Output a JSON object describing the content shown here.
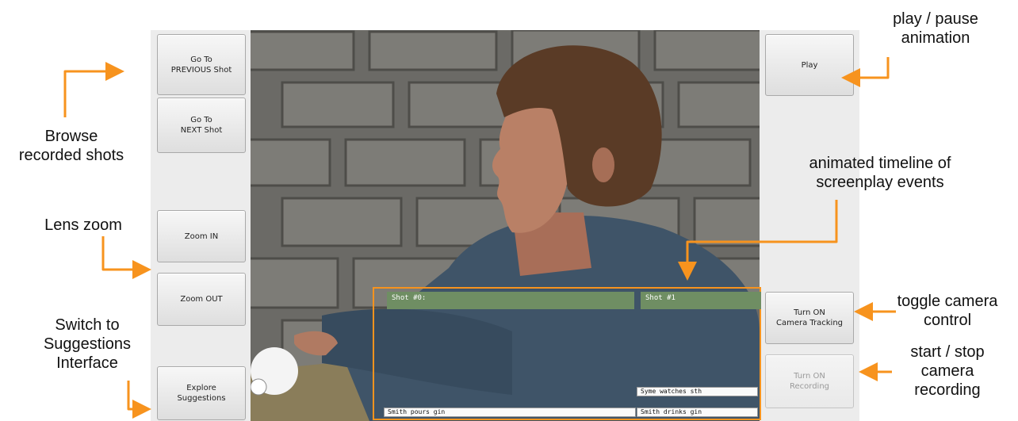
{
  "left_panel": {
    "buttons": [
      {
        "label": "Go To\nPREVIOUS Shot"
      },
      {
        "label": "Go To\nNEXT Shot"
      },
      {
        "label": "Zoom IN"
      },
      {
        "label": "Zoom OUT"
      },
      {
        "label": "Explore\nSuggestions"
      }
    ]
  },
  "right_panel": {
    "buttons": [
      {
        "label": "Play"
      },
      {
        "label": "Turn ON\nCamera Tracking"
      },
      {
        "label": "Turn ON\nRecording",
        "disabled": true
      }
    ]
  },
  "timeline": {
    "shots": [
      "Shot #0:",
      "Shot #1"
    ],
    "events": [
      "Syme watches sth",
      "Smith pours gin",
      "Smith drinks gin"
    ]
  },
  "annotations": {
    "browse": "Browse\nrecorded shots",
    "lens_zoom": "Lens zoom",
    "switch": "Switch to\nSuggestions\nInterface",
    "play_pause": "play / pause\nanimation",
    "timeline": "animated timeline of\nscreenplay events",
    "toggle_camera": "toggle camera\ncontrol",
    "recording": "start / stop\ncamera\nrecording"
  },
  "colors": {
    "arrow": "#f7931e",
    "shot_bar": "#6f8e63",
    "panel": "#ececec"
  }
}
